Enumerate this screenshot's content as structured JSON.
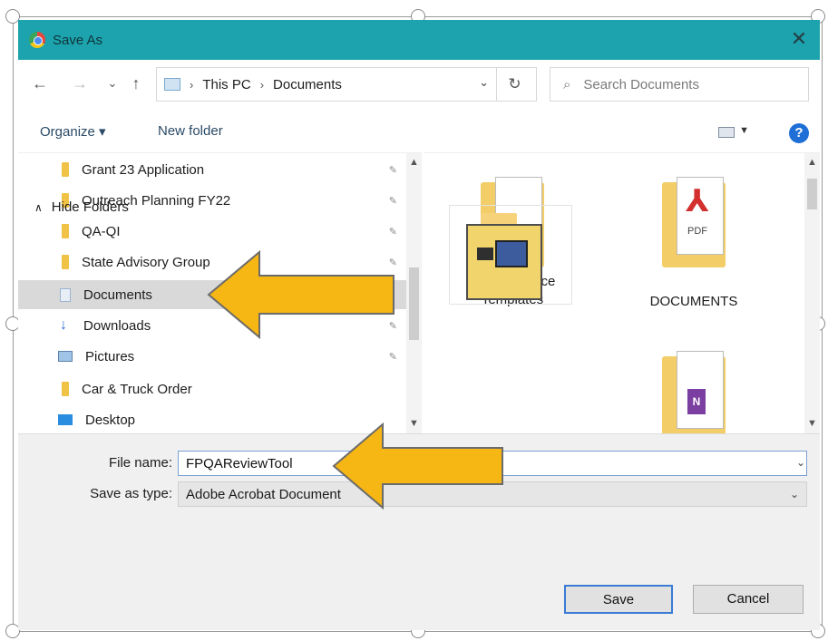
{
  "window": {
    "title": "Save As",
    "close_glyph": "✕",
    "app_icon": "chrome-icon"
  },
  "nav": {
    "back_glyph": "←",
    "forward_glyph": "→",
    "recent_glyph": "⌄",
    "up_glyph": "↑",
    "breadcrumb": [
      "This PC",
      "Documents"
    ],
    "crumb_separator": "›",
    "refresh_glyph": "↻",
    "search_placeholder": "Search Documents",
    "search_glyph": "⌕"
  },
  "toolbar": {
    "organize_label": "Organize ▾",
    "new_folder_label": "New folder",
    "view_drop_glyph": "▼",
    "help_glyph": "?"
  },
  "sidebar": {
    "items": [
      {
        "label": "Grant 23 Application",
        "icon": "folder-icon",
        "pinned": true
      },
      {
        "label": "Outreach Planning FY22",
        "icon": "folder-icon",
        "pinned": true
      },
      {
        "label": "QA-QI",
        "icon": "folder-icon",
        "pinned": true
      },
      {
        "label": "State Advisory Group",
        "icon": "folder-icon",
        "pinned": true
      },
      {
        "label": "Documents",
        "icon": "documents-icon",
        "pinned": false,
        "selected": true
      },
      {
        "label": "Downloads",
        "icon": "download-icon",
        "pinned": true
      },
      {
        "label": "Pictures",
        "icon": "pictures-icon",
        "pinned": true
      },
      {
        "label": "Car & Truck Order",
        "icon": "folder-icon",
        "pinned": false
      },
      {
        "label": "Desktop",
        "icon": "desktop-icon",
        "pinned": false
      }
    ],
    "pin_glyph": "✎"
  },
  "files": {
    "items": [
      {
        "label": "Custom Office Templates",
        "icon": "word-folder-icon"
      },
      {
        "label": "DOCUMENTS",
        "icon": "pdf-folder-icon",
        "badge": "PDF"
      },
      {
        "label": "",
        "icon": "app-folder-icon"
      },
      {
        "label": "",
        "icon": "onenote-folder-icon",
        "badge": "N"
      }
    ]
  },
  "form": {
    "filename_label": "File name:",
    "filename_value": "FPQAReviewTool",
    "savetype_label": "Save as type:",
    "savetype_value": "Adobe Acrobat Document",
    "drop_glyph": "⌄",
    "hide_folders_label": "Hide Folders",
    "hide_folders_glyph": "∧",
    "save_label": "Save",
    "cancel_label": "Cancel"
  },
  "colors": {
    "titlebar": "#1ca3ad",
    "annotation_arrow": "#f6b613",
    "selection": "#d9d9d9",
    "folder": "#f0c346"
  }
}
